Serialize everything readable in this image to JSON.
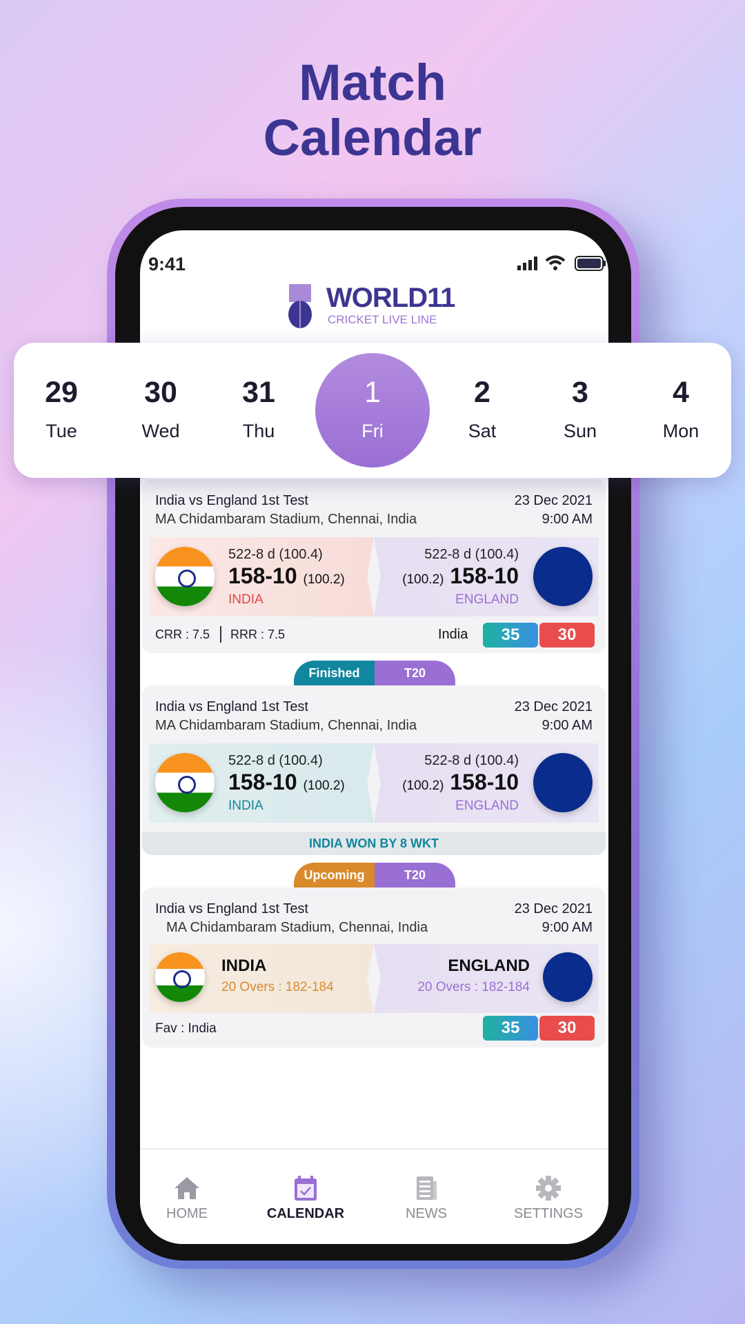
{
  "headline": {
    "line1": "Match",
    "line2": "Calendar"
  },
  "status": {
    "time": "9:41"
  },
  "logo": {
    "name": "WORLD11",
    "tagline": "CRICKET LIVE LINE"
  },
  "dates": [
    {
      "num": "29",
      "day": "Tue"
    },
    {
      "num": "30",
      "day": "Wed"
    },
    {
      "num": "31",
      "day": "Thu"
    },
    {
      "num": "1",
      "day": "Fri",
      "selected": true
    },
    {
      "num": "2",
      "day": "Sat"
    },
    {
      "num": "3",
      "day": "Sun"
    },
    {
      "num": "4",
      "day": "Mon"
    }
  ],
  "matches": [
    {
      "title": "India vs England 1st Test",
      "venue": "MA Chidambaram Stadium, Chennai, India",
      "date": "23 Dec 2021",
      "time": "9:00 AM",
      "team1": {
        "name": "INDIA",
        "first": "522-8 d (100.4)",
        "score": "158-10",
        "overs": "(100.2)"
      },
      "team2": {
        "name": "ENGLAND",
        "first": "522-8 d (100.4)",
        "score": "158-10",
        "overs": "(100.2)"
      },
      "crr": "CRR : 7.5",
      "rrr": "RRR : 7.5",
      "fav": "India",
      "odds": [
        "35",
        "30"
      ]
    },
    {
      "status": "Finished",
      "format": "T20",
      "title": "India vs England 1st Test",
      "venue": "MA Chidambaram Stadium, Chennai, India",
      "date": "23 Dec 2021",
      "time": "9:00 AM",
      "team1": {
        "name": "INDIA",
        "first": "522-8 d (100.4)",
        "score": "158-10",
        "overs": "(100.2)"
      },
      "team2": {
        "name": "ENGLAND",
        "first": "522-8 d (100.4)",
        "score": "158-10",
        "overs": "(100.2)"
      },
      "result": "INDIA WON BY 8 WKT"
    },
    {
      "status": "Upcoming",
      "format": "T20",
      "title": "India vs England 1st Test",
      "venue": "MA Chidambaram Stadium, Chennai, India",
      "date": "23 Dec 2021",
      "time": "9:00 AM",
      "team1": {
        "name": "INDIA",
        "overs": "20 Overs : 182-184"
      },
      "team2": {
        "name": "ENGLAND",
        "overs": "20 Overs : 182-184"
      },
      "fav": "Fav : India",
      "odds": [
        "35",
        "30"
      ]
    }
  ],
  "nav": [
    {
      "label": "HOME",
      "icon": "home-icon"
    },
    {
      "label": "CALENDAR",
      "icon": "calendar-icon",
      "active": true
    },
    {
      "label": "NEWS",
      "icon": "news-icon"
    },
    {
      "label": "SETTINGS",
      "icon": "gear-icon"
    }
  ],
  "colors": {
    "accent": "#9a6fd3",
    "brand": "#3d3592",
    "finished": "#11869e",
    "upcoming": "#d98a2b",
    "odd_back": "#3a8fe0",
    "odd_lay": "#e84c4c"
  }
}
